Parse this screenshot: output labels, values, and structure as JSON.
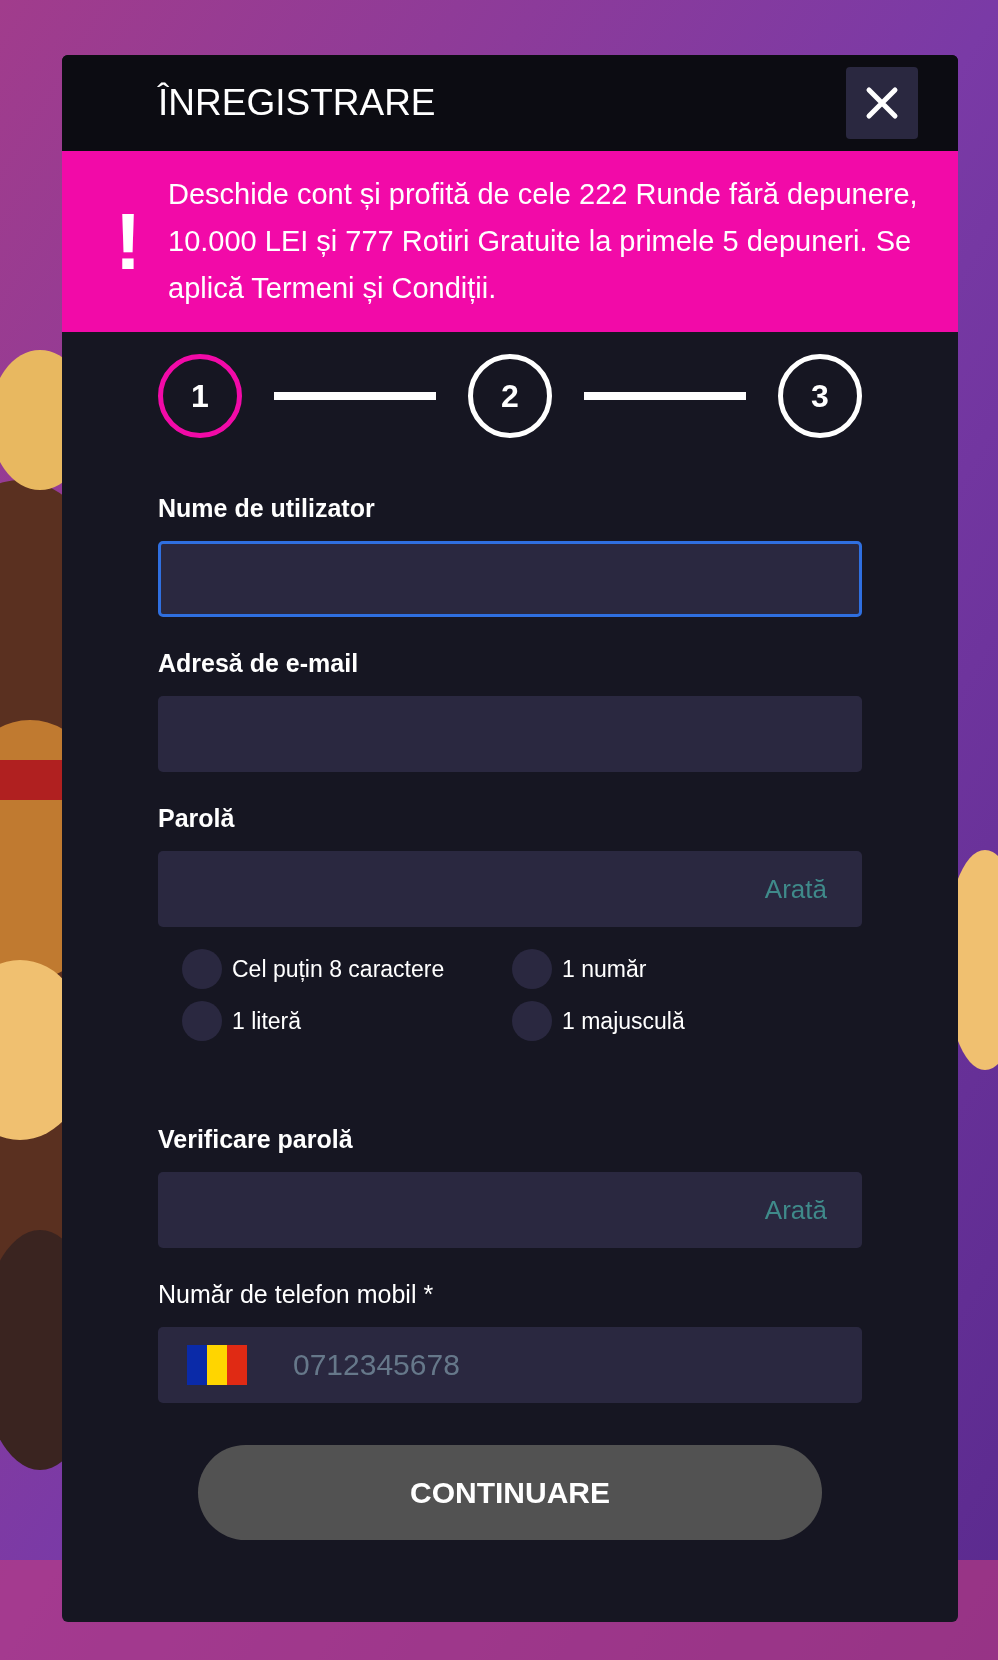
{
  "dialog": {
    "title": "ÎNREGISTRARE"
  },
  "banner": {
    "icon": "!",
    "text": "Deschide cont și profită de cele 222 Runde fără depunere, 10.000 LEI și 777 Rotiri Gratuite la primele 5 depuneri. Se aplică Termeni și Condiții."
  },
  "steps": [
    {
      "label": "1",
      "selected": true
    },
    {
      "label": "2",
      "selected": false
    },
    {
      "label": "3",
      "selected": false
    }
  ],
  "fields": [
    {
      "kind": "text",
      "label": "Nume de utilizator",
      "focused": true
    },
    {
      "kind": "text",
      "label": "Adresă de e-mail",
      "focused": false
    },
    {
      "kind": "password",
      "label": "Parolă",
      "focused": false,
      "toggle": "Arată",
      "requirements": [
        {
          "label": "Cel puțin 8 caractere",
          "checked": false
        },
        {
          "label": "1 număr",
          "checked": false
        },
        {
          "label": "1 literă",
          "checked": false
        },
        {
          "label": "1 majusculă",
          "checked": false
        }
      ]
    },
    {
      "kind": "password",
      "label": "Verificare parolă",
      "focused": false,
      "toggle": "Arată"
    },
    {
      "kind": "phone",
      "label": "Număr de telefon mobil *",
      "focused": false,
      "placeholder": "0712345678"
    }
  ],
  "submit": {
    "label": "CONTINUARE",
    "disabled": true
  }
}
